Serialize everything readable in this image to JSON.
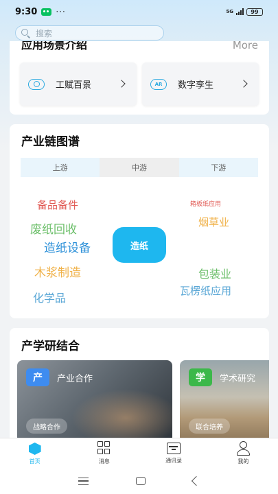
{
  "status": {
    "time": "9:30",
    "network": "5G",
    "battery": "99"
  },
  "search": {
    "placeholder": "搜索"
  },
  "scenario": {
    "title": "应用场景介绍",
    "more": "More",
    "items": [
      {
        "label": "工赋百景",
        "icon": "vr-headset-icon"
      },
      {
        "label": "数字孪生",
        "icon": "ar-glasses-icon",
        "icon_text": "AR"
      }
    ]
  },
  "chain": {
    "title": "产业链图谱",
    "tabs": [
      "上游",
      "中游",
      "下游"
    ],
    "active_tab": "中游",
    "center": "造纸",
    "words": [
      {
        "text": "备品备件",
        "color": "#e15b55"
      },
      {
        "text": "箱板纸应用",
        "color": "#e15b55"
      },
      {
        "text": "废纸回收",
        "color": "#6cbf6a"
      },
      {
        "text": "烟草业",
        "color": "#f0b24a"
      },
      {
        "text": "造纸设备",
        "color": "#2a8fd8"
      },
      {
        "text": "木浆制造",
        "color": "#f0b24a"
      },
      {
        "text": "包装业",
        "color": "#6cbf6a"
      },
      {
        "text": "瓦楞纸应用",
        "color": "#5aa7d6"
      },
      {
        "text": "化学品",
        "color": "#5aa7d6"
      }
    ]
  },
  "research": {
    "title": "产学研结合",
    "items": [
      {
        "badge": "产",
        "badge_color": "#3e8cf0",
        "title": "产业合作",
        "tag": "战略合作"
      },
      {
        "badge": "学",
        "badge_color": "#3cb84a",
        "title": "学术研究",
        "tag": "联合培养"
      }
    ]
  },
  "tabbar": {
    "items": [
      {
        "label": "首页",
        "active": true
      },
      {
        "label": "消息"
      },
      {
        "label": "通讯录"
      },
      {
        "label": "我的"
      }
    ]
  },
  "colors": {
    "accent": "#1eb7ef"
  }
}
